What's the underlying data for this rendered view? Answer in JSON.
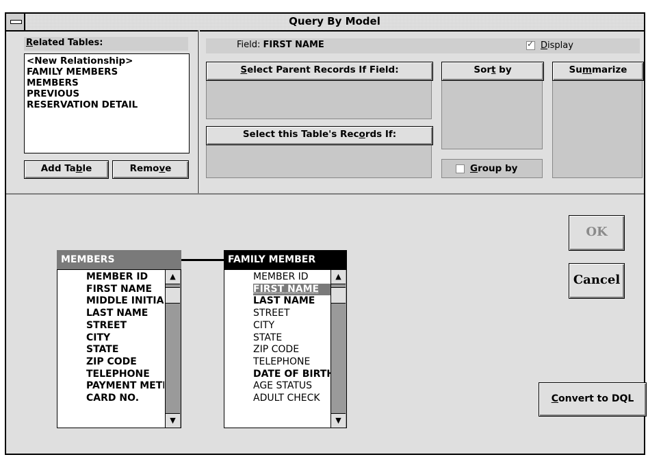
{
  "window": {
    "title": "Query By Model"
  },
  "related_tables": {
    "label": "Related Tables:",
    "items": [
      "<New Relationship>",
      "FAMILY MEMBERS",
      "MEMBERS",
      "PREVIOUS",
      "RESERVATION DETAIL"
    ],
    "add_button": "Add Table",
    "remove_button": "Remove"
  },
  "field": {
    "prefix": "Field:",
    "name": "FIRST NAME",
    "display_label": "Display",
    "display_checked": true
  },
  "criteria": {
    "select_parent_label": "Select Parent Records If Field:",
    "select_this_label": "Select this Table's Records If:",
    "sort_by_label": "Sort by",
    "summarize_label": "Summarize",
    "group_by_label": "Group by",
    "group_by_checked": false
  },
  "members_table": {
    "title": "MEMBERS",
    "fields": [
      "MEMBER ID",
      "FIRST NAME",
      "MIDDLE INITIAL",
      "LAST NAME",
      "STREET",
      "CITY",
      "STATE",
      "ZIP CODE",
      "TELEPHONE",
      "PAYMENT METHOD",
      "CARD NO."
    ]
  },
  "family_table": {
    "title": "FAMILY MEMBER",
    "fields": [
      "MEMBER ID",
      "FIRST NAME",
      "LAST NAME",
      "STREET",
      "CITY",
      "STATE",
      "ZIP CODE",
      "TELEPHONE",
      "DATE OF BIRTH",
      "AGE STATUS",
      "ADULT CHECK"
    ],
    "selected_field": "FIRST NAME"
  },
  "buttons": {
    "ok": "OK",
    "cancel": "Cancel",
    "convert": "Convert to DQL"
  },
  "colors": {
    "window_bg": "#dfdfdf",
    "selected": "#7a7a7a",
    "header_active": "#000000",
    "header_inactive": "#7a7a7a"
  }
}
